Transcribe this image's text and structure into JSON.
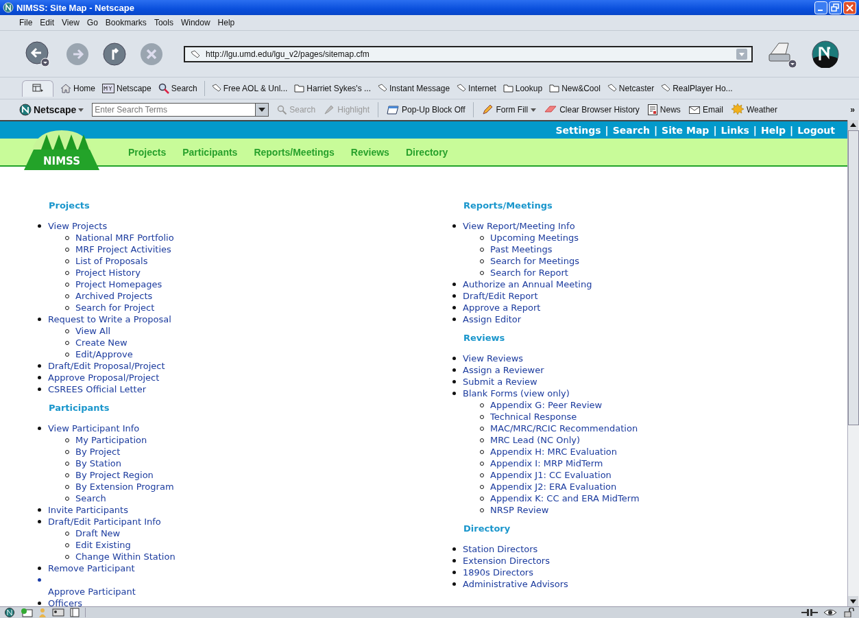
{
  "window": {
    "title": "NIMSS: Site Map - Netscape"
  },
  "menu": [
    "File",
    "Edit",
    "View",
    "Go",
    "Bookmarks",
    "Tools",
    "Window",
    "Help"
  ],
  "address": {
    "value": "http://lgu.umd.edu/lgu_v2/pages/sitemap.cfm"
  },
  "personal_toolbar": [
    {
      "label": "Home",
      "kind": "home"
    },
    {
      "label": "Netscape",
      "kind": "my"
    },
    {
      "label": "Search",
      "kind": "search"
    },
    {
      "label": "Free AOL & Unl...",
      "kind": "bookmark"
    },
    {
      "label": "Harriet Sykes's ...",
      "kind": "folder"
    },
    {
      "label": "Instant Message",
      "kind": "bookmark"
    },
    {
      "label": "Internet",
      "kind": "bookmark"
    },
    {
      "label": "Lookup",
      "kind": "folder"
    },
    {
      "label": "New&Cool",
      "kind": "folder"
    },
    {
      "label": "Netcaster",
      "kind": "bookmark"
    },
    {
      "label": "RealPlayer Ho...",
      "kind": "bookmark"
    }
  ],
  "search_toolbar": {
    "brand": "Netscape",
    "placeholder": "Enter Search Terms",
    "items": [
      {
        "label": "Search",
        "kind": "search",
        "disabled": true
      },
      {
        "label": "Highlight",
        "kind": "highlight",
        "disabled": true
      },
      {
        "label": "Pop-Up Block Off",
        "kind": "popup",
        "disabled": false
      },
      {
        "label": "Form Fill",
        "kind": "formfill",
        "disabled": false
      },
      {
        "label": "Clear Browser History",
        "kind": "eraser",
        "disabled": false
      },
      {
        "label": "News",
        "kind": "news",
        "disabled": false
      },
      {
        "label": "Email",
        "kind": "email",
        "disabled": false
      },
      {
        "label": "Weather",
        "kind": "weather",
        "disabled": false
      }
    ],
    "overflow": "»"
  },
  "site_header": {
    "logo": "NIMSS",
    "separator": "|",
    "links": [
      "Settings",
      "Search",
      "Site Map",
      "Links",
      "Help",
      "Logout"
    ],
    "nav": [
      "Projects",
      "Participants",
      "Reports/Meetings",
      "Reviews",
      "Directory"
    ]
  },
  "columns": [
    [
      {
        "heading": "Projects",
        "items": [
          {
            "label": "View Projects",
            "children": [
              {
                "label": "National MRF Portfolio"
              },
              {
                "label": "MRF Project Activities"
              },
              {
                "label": "List of Proposals"
              },
              {
                "label": "Project History"
              },
              {
                "label": "Project Homepages"
              },
              {
                "label": "Archived Projects"
              },
              {
                "label": "Search for Project"
              }
            ]
          },
          {
            "label": "Request to Write a Proposal",
            "children": [
              {
                "label": "View All"
              },
              {
                "label": "Create New"
              },
              {
                "label": "Edit/Approve"
              }
            ]
          },
          {
            "label": "Draft/Edit Proposal/Project"
          },
          {
            "label": "Approve Proposal/Project"
          },
          {
            "label": "CSREES Official Letter"
          }
        ]
      },
      {
        "heading": "Participants",
        "items": [
          {
            "label": "View Participant Info",
            "children": [
              {
                "label": "My Participation"
              },
              {
                "label": "By Project"
              },
              {
                "label": "By Station"
              },
              {
                "label": "By Project Region"
              },
              {
                "label": "By Extension Program"
              },
              {
                "label": "Search"
              }
            ]
          },
          {
            "label": "Invite Participants"
          },
          {
            "label": "Draft/Edit Participant Info",
            "children": [
              {
                "label": "Draft New"
              },
              {
                "label": "Edit Existing"
              },
              {
                "label": "Change Within Station"
              }
            ]
          },
          {
            "label": "Remove Participant"
          },
          {
            "label": "Approve Participant",
            "kind": "detached"
          },
          {
            "label": "Officers"
          }
        ]
      }
    ],
    [
      {
        "heading": "Reports/Meetings",
        "items": [
          {
            "label": "View Report/Meeting Info",
            "children": [
              {
                "label": "Upcoming Meetings"
              },
              {
                "label": "Past Meetings"
              },
              {
                "label": "Search for Meetings"
              },
              {
                "label": "Search for Report"
              }
            ]
          },
          {
            "label": "Authorize an Annual Meeting"
          },
          {
            "label": "Draft/Edit Report"
          },
          {
            "label": "Approve a Report"
          },
          {
            "label": "Assign Editor"
          }
        ]
      },
      {
        "heading": "Reviews",
        "items": [
          {
            "label": "View Reviews"
          },
          {
            "label": "Assign a Reviewer"
          },
          {
            "label": "Submit a Review"
          },
          {
            "label": "Blank Forms (view only)",
            "children": [
              {
                "label": "Appendix G: Peer Review"
              },
              {
                "label": "Technical Response"
              },
              {
                "label": "MAC/MRC/RCIC Recommendation"
              },
              {
                "label": "MRC Lead (NC Only)"
              },
              {
                "label": "Appendix H: MRC Evaluation"
              },
              {
                "label": "Appendix I: MRP MidTerm"
              },
              {
                "label": "Appendix J1: CC Evaluation"
              },
              {
                "label": "Appendix J2: ERA Evaluation"
              },
              {
                "label": "Appendix K: CC and ERA MidTerm"
              },
              {
                "label": "NRSP Review"
              }
            ]
          }
        ]
      },
      {
        "heading": "Directory",
        "items": [
          {
            "label": "Station Directors"
          },
          {
            "label": "Extension Directors"
          },
          {
            "label": "1890s Directors"
          },
          {
            "label": "Administrative Advisors"
          }
        ]
      }
    ]
  ]
}
